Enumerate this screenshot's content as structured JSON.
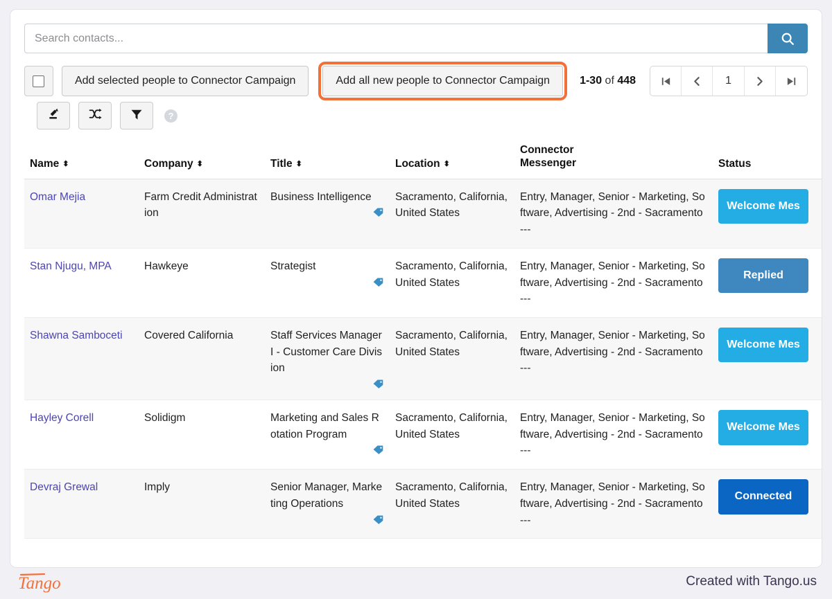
{
  "search": {
    "placeholder": "Search contacts...",
    "value": "",
    "button_icon": "search-icon"
  },
  "toolbar": {
    "select_all_checkbox": "",
    "add_selected_label": "Add selected people to Connector Campaign",
    "add_all_new_label": "Add all new people to Connector Campaign",
    "add_all_new_highlight_color": "#f2713b",
    "icons": [
      {
        "name": "export-icon",
        "label": "Export"
      },
      {
        "name": "shuffle-icon",
        "label": "Shuffle"
      },
      {
        "name": "filter-icon",
        "label": "Filter"
      }
    ],
    "help_label": "?"
  },
  "pagination": {
    "range": "1-30",
    "of_word": "of",
    "total": "448",
    "first_label": "⏮",
    "prev_label": "‹",
    "current_page": "1",
    "next_label": "›",
    "last_label": "⏭"
  },
  "table": {
    "columns": [
      {
        "key": "name",
        "label": "Name",
        "sortable": true
      },
      {
        "key": "company",
        "label": "Company",
        "sortable": true
      },
      {
        "key": "title",
        "label": "Title",
        "sortable": true
      },
      {
        "key": "location",
        "label": "Location",
        "sortable": true
      },
      {
        "key": "connector",
        "label_line1": "Connector",
        "label_line2": "Messenger",
        "sortable": false
      },
      {
        "key": "status",
        "label": "Status",
        "sortable": false
      }
    ],
    "rows": [
      {
        "name": "Omar Mejia",
        "company": "Farm Credit Administration",
        "title": "Business Intelligence",
        "location": "Sacramento, California, United States",
        "connector": "Entry, Manager, Senior - Marketing, Software, Advertising - 2nd - Sacramento",
        "connector_sub": "---",
        "status": "Welcome Mes",
        "status_style": "welcome"
      },
      {
        "name": "Stan Njugu, MPA",
        "company": "Hawkeye",
        "title": "Strategist",
        "location": "Sacramento, California, United States",
        "connector": "Entry, Manager, Senior - Marketing, Software, Advertising - 2nd - Sacramento",
        "connector_sub": "---",
        "status": "Replied",
        "status_style": "replied"
      },
      {
        "name": "Shawna Samboceti",
        "company": "Covered California",
        "title": "Staff Services Manager I - Customer Care Division",
        "location": "Sacramento, California, United States",
        "connector": "Entry, Manager, Senior - Marketing, Software, Advertising - 2nd - Sacramento",
        "connector_sub": "---",
        "status": "Welcome Mes",
        "status_style": "welcome"
      },
      {
        "name": "Hayley Corell",
        "company": "Solidigm",
        "title": "Marketing and Sales Rotation Program",
        "location": "Sacramento, California, United States",
        "connector": "Entry, Manager, Senior - Marketing, Software, Advertising - 2nd - Sacramento",
        "connector_sub": "---",
        "status": "Welcome Mes",
        "status_style": "welcome"
      },
      {
        "name": "Devraj Grewal",
        "company": "Imply",
        "title": "Senior Manager, Marketing Operations",
        "location": "Sacramento, California, United States",
        "connector": "Entry, Manager, Senior - Marketing, Software, Advertising - 2nd - Sacramento",
        "connector_sub": "---",
        "status": "Connected",
        "status_style": "connected"
      }
    ]
  },
  "footer": {
    "logo_text": "Tango",
    "created_with": "Created with Tango.us"
  },
  "colors": {
    "accent_highlight": "#f2713b",
    "search_button": "#3b86b5",
    "badge_welcome": "#23ade4",
    "badge_replied": "#3f87bf",
    "badge_connected": "#0a66c2",
    "name_link": "#4b45b2",
    "tag_icon": "#3a8fc7",
    "page_background": "#f1f0f5"
  }
}
